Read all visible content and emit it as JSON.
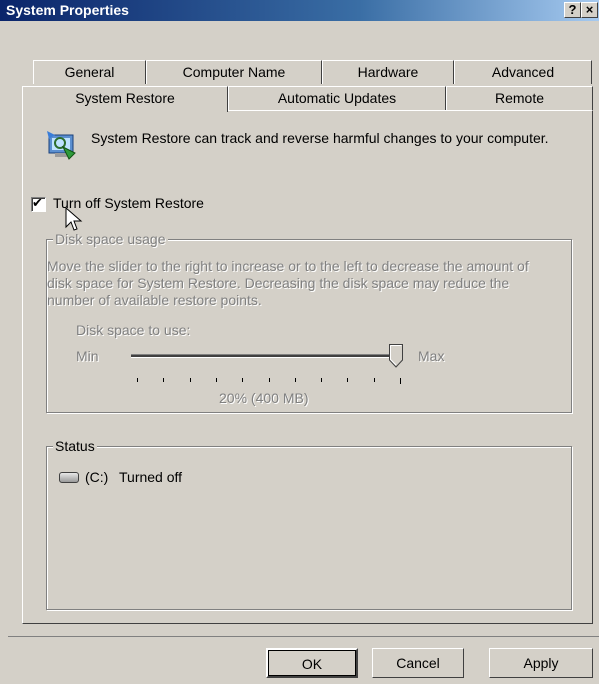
{
  "window": {
    "title": "System Properties",
    "help_label": "?",
    "close_label": "×"
  },
  "tabs_row1": [
    "General",
    "Computer Name",
    "Hardware",
    "Advanced"
  ],
  "tabs_row2": [
    "System Restore",
    "Automatic Updates",
    "Remote"
  ],
  "active_tab": "System Restore",
  "intro": {
    "text": "System Restore can track and reverse harmful changes to your computer."
  },
  "checkbox": {
    "label": "Turn off System Restore",
    "checked": true,
    "mark": "✔"
  },
  "disk_group": {
    "legend": "Disk space usage",
    "description": "Move the slider to the right to increase or to the left to decrease the amount of disk space for System Restore. Decreasing the disk space may reduce the number of available restore points.",
    "slider_label": "Disk space to use:",
    "min_label": "Min",
    "max_label": "Max",
    "value_text": "20% (400 MB)",
    "slider_fraction": 1.0
  },
  "status_group": {
    "legend": "Status",
    "items": [
      {
        "drive": "(C:)",
        "state": "Turned off",
        "icon": "drive-icon"
      }
    ]
  },
  "buttons": {
    "ok": "OK",
    "cancel": "Cancel",
    "apply": "Apply"
  }
}
